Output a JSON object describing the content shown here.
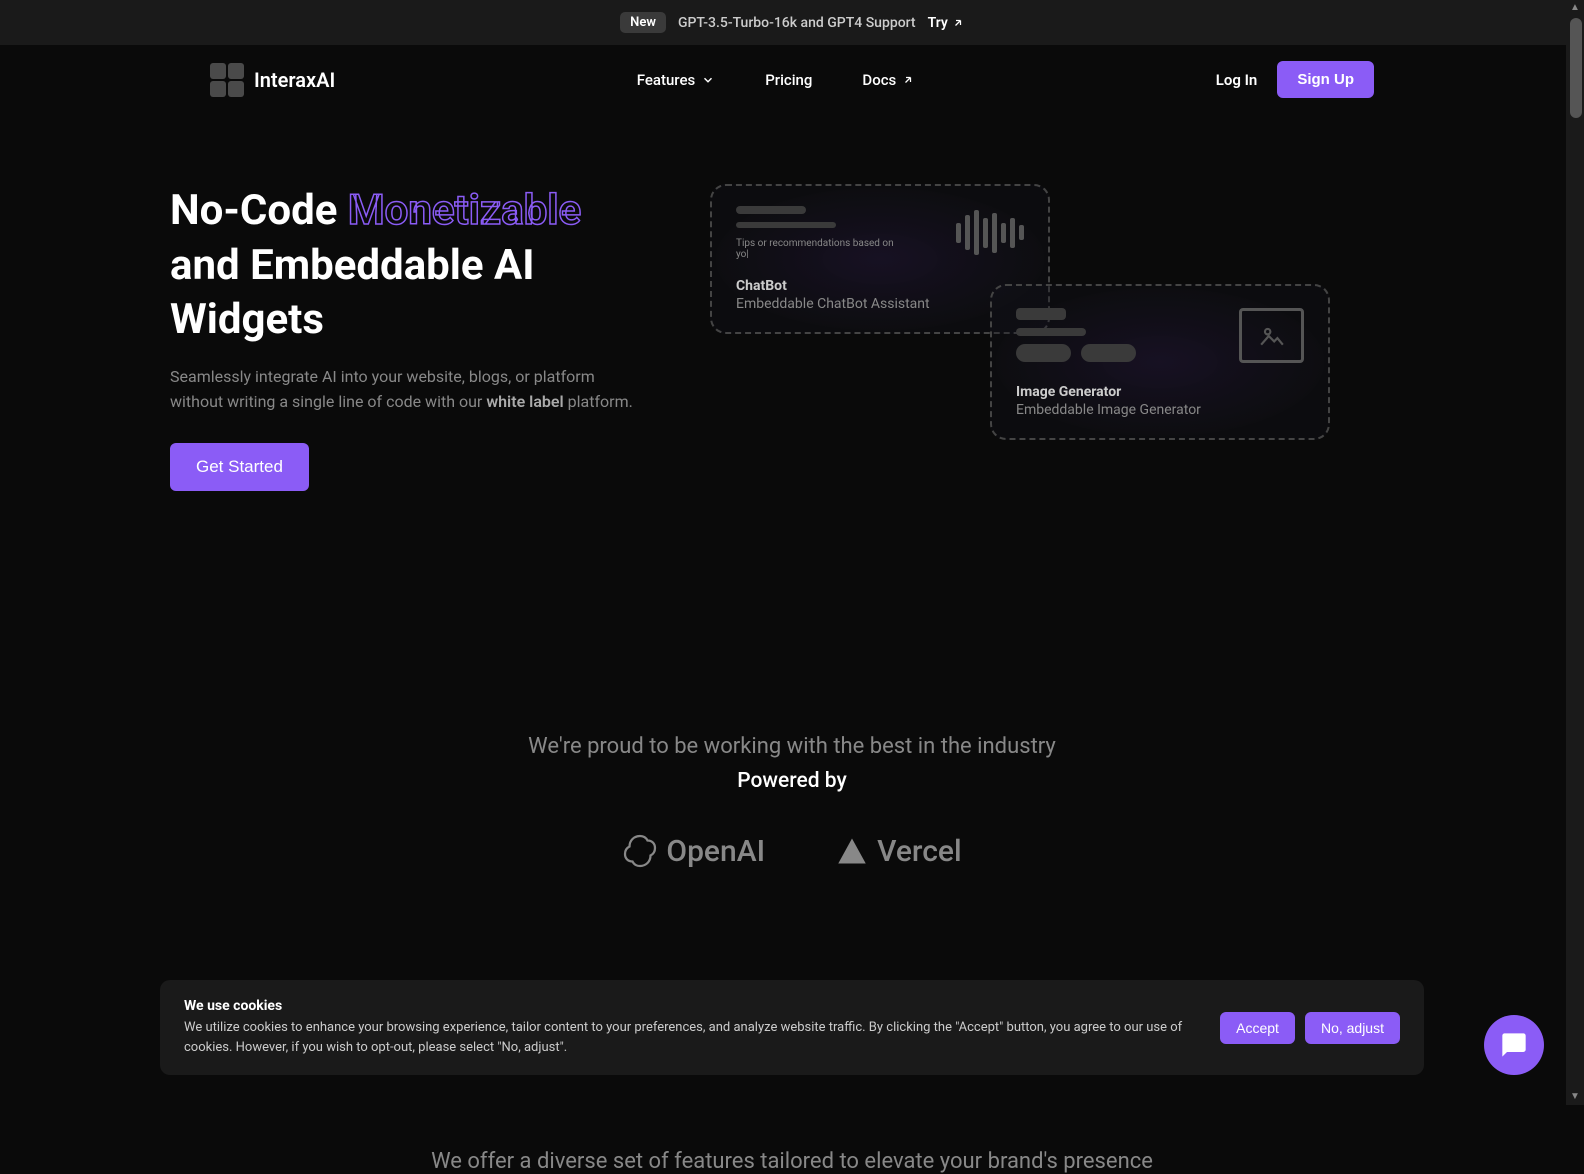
{
  "announcement": {
    "badge": "New",
    "text": "GPT-3.5-Turbo-16k and GPT4 Support",
    "cta": "Try"
  },
  "brand": {
    "name": "InteraxAI"
  },
  "nav": {
    "features": "Features",
    "pricing": "Pricing",
    "docs": "Docs",
    "login": "Log In",
    "signup": "Sign Up"
  },
  "hero": {
    "title_part1": "No-Code ",
    "title_highlight": "Monetizable",
    "title_part2": " and Embeddable AI Widgets",
    "description_part1": "Seamlessly integrate AI into your website, blogs, or platform without writing a single line of code with our ",
    "description_bold": "white label",
    "description_part2": " platform.",
    "cta": "Get Started"
  },
  "widgets": {
    "chatbot": {
      "prompt": "Tips or recommendations based on yo|",
      "title": "ChatBot",
      "subtitle": "Embeddable ChatBot Assistant"
    },
    "image_gen": {
      "title": "Image Generator",
      "subtitle": "Embeddable Image Generator"
    }
  },
  "partners": {
    "tagline": "We're proud to be working with the best in the industry",
    "heading": "Powered by",
    "logo1": "OpenAI",
    "logo2": "Vercel"
  },
  "features_section": {
    "tagline": "We offer a diverse set of features tailored to elevate your brand's presence"
  },
  "cookies": {
    "title": "We use cookies",
    "description": "We utilize cookies to enhance your browsing experience, tailor content to your preferences, and analyze website traffic. By clicking the \"Accept\" button, you agree to our use of cookies. However, if you wish to opt-out, please select \"No, adjust\".",
    "accept": "Accept",
    "reject": "No, adjust"
  }
}
